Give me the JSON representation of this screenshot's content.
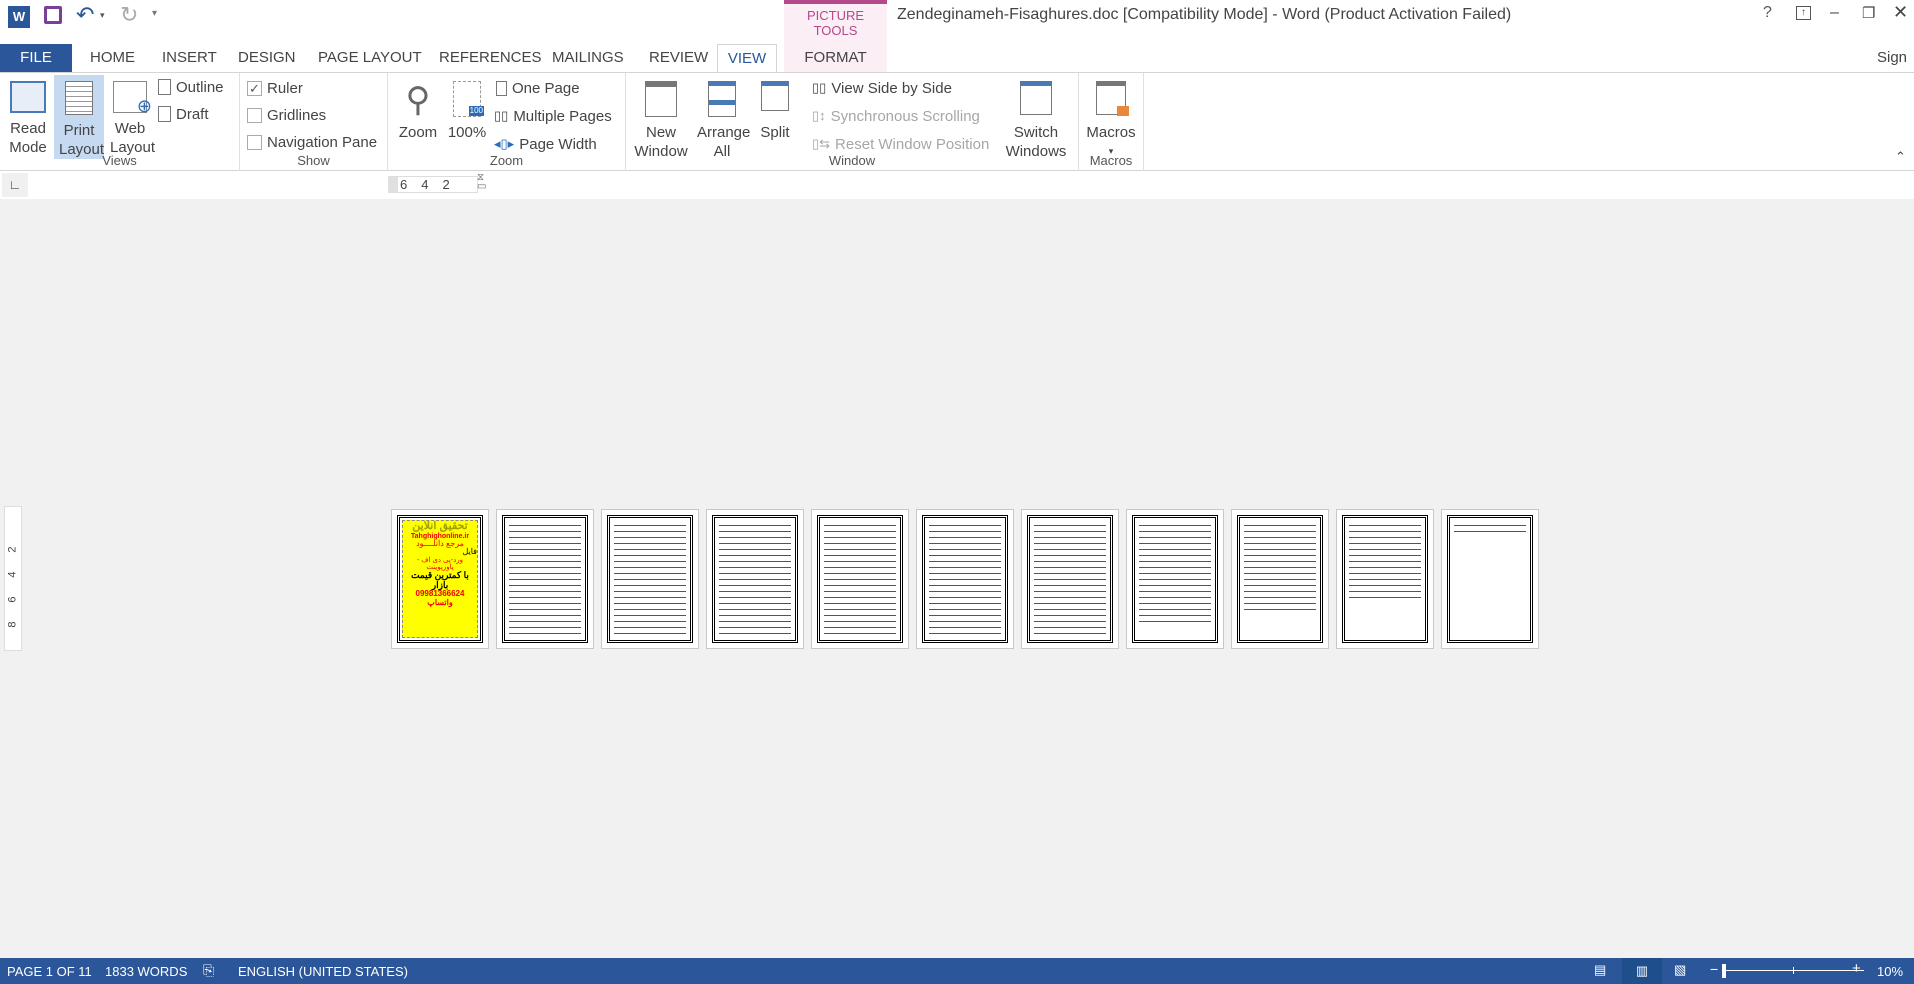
{
  "app": {
    "title": "Zendeginameh-Fisaghures.doc [Compatibility Mode] - Word (Product Activation Failed)",
    "help": "?",
    "sign_in": "Sign in",
    "contextual_group": "PICTURE TOOLS",
    "accent": "#2b579a",
    "contextual_color": "#b4498b"
  },
  "tabs": [
    {
      "label": "FILE"
    },
    {
      "label": "HOME"
    },
    {
      "label": "INSERT"
    },
    {
      "label": "DESIGN"
    },
    {
      "label": "PAGE LAYOUT"
    },
    {
      "label": "REFERENCES"
    },
    {
      "label": "MAILINGS"
    },
    {
      "label": "REVIEW"
    },
    {
      "label": "VIEW",
      "active": true
    },
    {
      "label": "FORMAT"
    }
  ],
  "ribbon": {
    "views": {
      "label": "Views",
      "read_mode": "Read Mode",
      "print_layout": "Print Layout",
      "web_layout": "Web Layout",
      "outline": "Outline",
      "draft": "Draft"
    },
    "show": {
      "label": "Show",
      "ruler": "Ruler",
      "ruler_checked": true,
      "gridlines": "Gridlines",
      "gridlines_checked": false,
      "nav_pane": "Navigation Pane",
      "nav_pane_checked": false
    },
    "zoom": {
      "label": "Zoom",
      "zoom": "Zoom",
      "hundred": "100%",
      "badge": "100",
      "one_page": "One Page",
      "multiple_pages": "Multiple Pages",
      "page_width": "Page Width"
    },
    "window": {
      "label": "Window",
      "new_window": "New Window",
      "arrange_all": "Arrange All",
      "split": "Split",
      "side_by_side": "View Side by Side",
      "sync_scroll": "Synchronous Scrolling",
      "reset_pos": "Reset Window Position",
      "switch_windows": "Switch Windows"
    },
    "macros": {
      "label": "Macros",
      "macros": "Macros"
    }
  },
  "ruler": {
    "h_ticks": [
      "6",
      "4",
      "2"
    ],
    "v_ticks": [
      "2",
      "4",
      "6",
      "8"
    ]
  },
  "document": {
    "page_count": 11,
    "cover": {
      "title": "تحقیق آنلاین",
      "site": "Tahghighonline.ir",
      "line1": "مرجع دانلــــود",
      "line2": "فایل",
      "line3": "ورد-پی دی اف - پاورپوینت",
      "line4": "با کمترین قیمت بازار",
      "line5": "09981366624 واتساپ"
    }
  },
  "status": {
    "page": "PAGE 1 OF 11",
    "words": "1833 WORDS",
    "language": "ENGLISH (UNITED STATES)",
    "zoom": "10%",
    "zoom_level_percent": 10
  }
}
